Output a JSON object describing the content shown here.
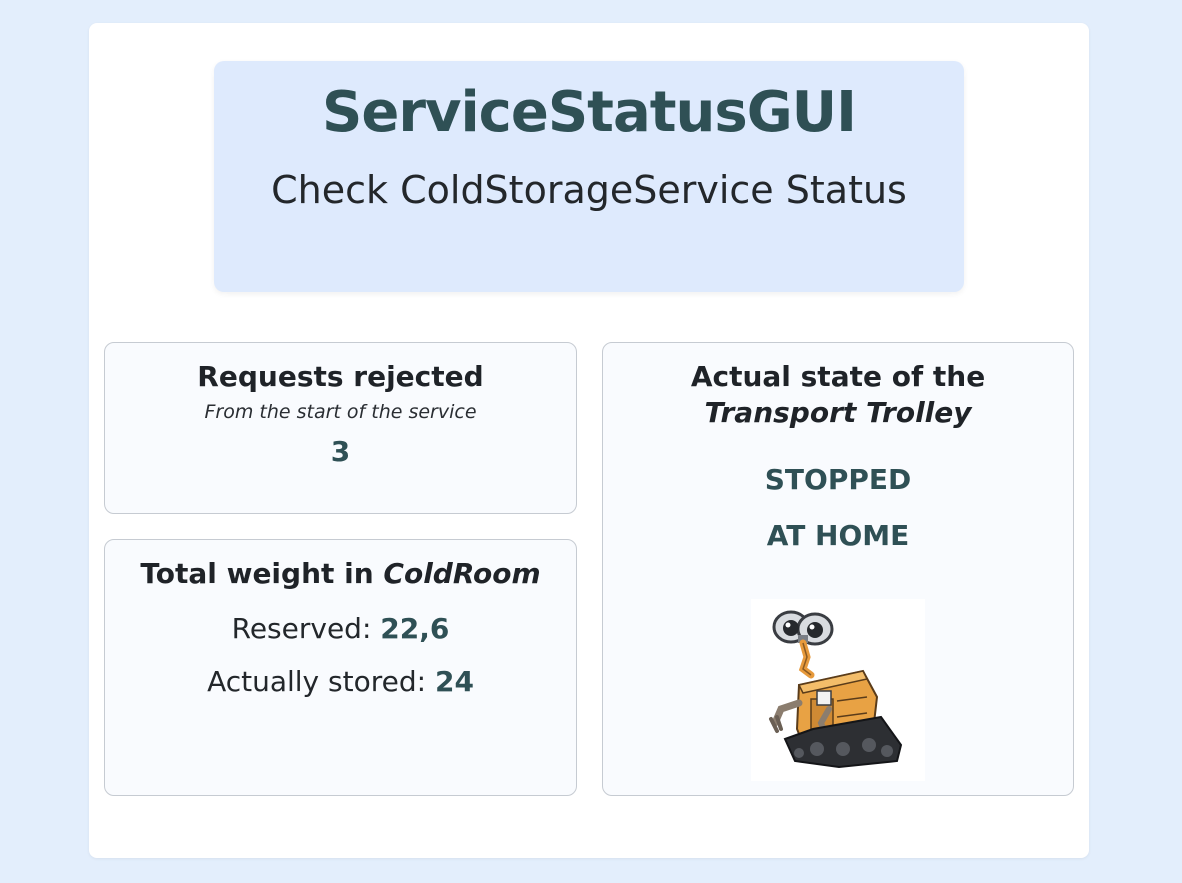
{
  "header": {
    "title": "ServiceStatusGUI",
    "subtitle": "Check ColdStorageService Status"
  },
  "rejected": {
    "title": "Requests rejected",
    "caption": "From the start of the service",
    "value": "3"
  },
  "weight": {
    "title_prefix": "Total weight in ",
    "title_emph": "ColdRoom",
    "reserved_label": "Reserved: ",
    "reserved_value": "22,6",
    "stored_label": "Actually stored: ",
    "stored_value": "24"
  },
  "trolley": {
    "title_line1": "Actual state of the",
    "title_line2": "Transport Trolley",
    "state": "STOPPED",
    "location": "AT HOME",
    "image_icon": "robot-icon"
  },
  "colors": {
    "accent": "#2f5055",
    "background": "#e3eefc",
    "header_bg": "#deeafd"
  }
}
